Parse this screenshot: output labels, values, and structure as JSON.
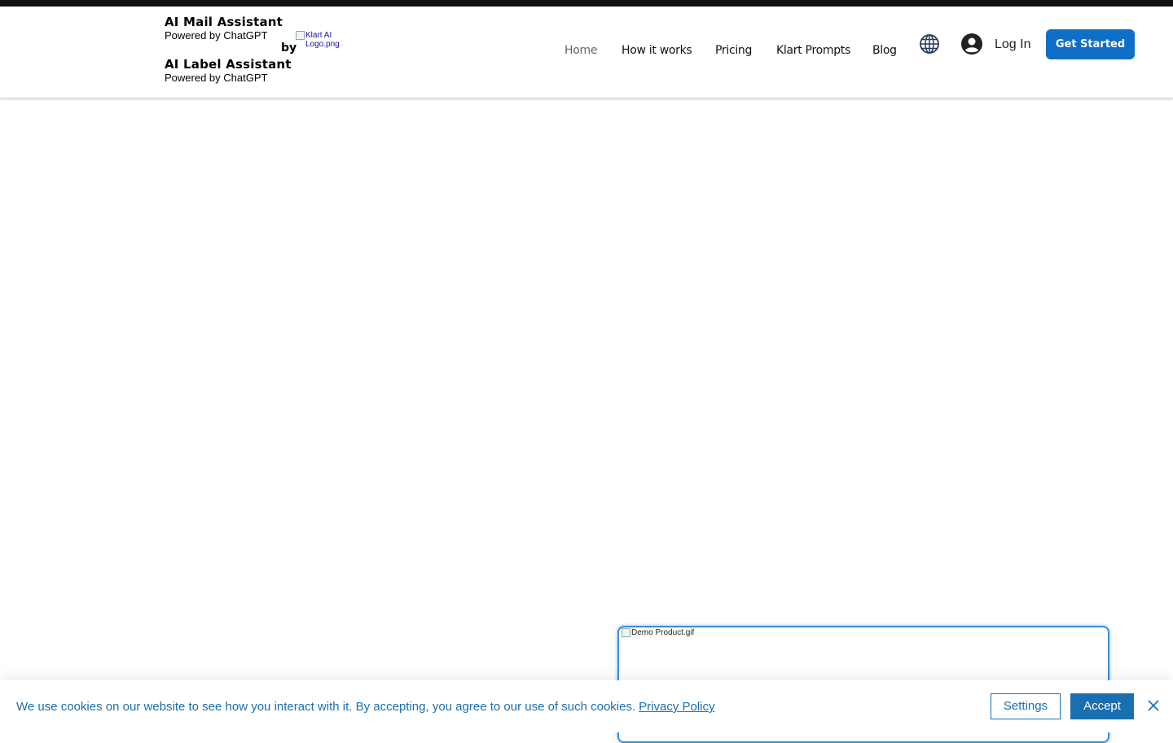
{
  "header": {
    "brand_1_title": "AI Mail Assistant",
    "brand_1_sub": "Powered by ChatGPT",
    "brand_2_title": "AI Label Assistant",
    "brand_2_sub": "Powered by ChatGPT",
    "by_label": "by",
    "logo_alt_line1": "Klart AI",
    "logo_alt_line2": "Logo.png"
  },
  "nav": {
    "items": [
      {
        "label": "Home",
        "active": true
      },
      {
        "label": "How it works",
        "active": false
      },
      {
        "label": "Pricing",
        "active": false
      },
      {
        "label": "Klart Prompts",
        "active": false
      },
      {
        "label": "Blog",
        "active": false
      }
    ],
    "language_icon": "globe-icon",
    "login_icon": "user-avatar-icon",
    "login_label": "Log In",
    "cta_label": "Get Started"
  },
  "main": {
    "demo_image_alt": "Demo Product.gif"
  },
  "cookie_banner": {
    "message": "We use cookies on our website to see how you interact with it. By accepting, you agree to our use of such cookies.",
    "policy_link": "Privacy Policy",
    "settings_label": "Settings",
    "accept_label": "Accept",
    "close_icon": "close-icon"
  },
  "colors": {
    "accent": "#0f6fc6",
    "cookie_blue": "#1a6fb0",
    "nav_active": "#666666",
    "globe": "#2a3a5a"
  }
}
